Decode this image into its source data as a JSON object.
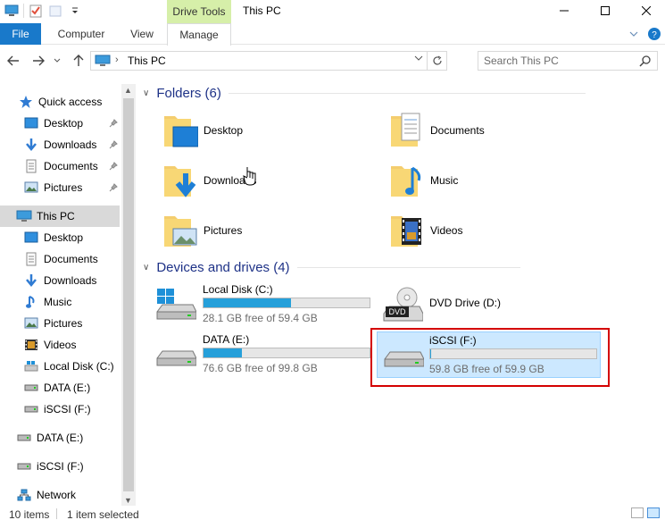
{
  "titlebar": {
    "contextual_tab": "Drive Tools",
    "title": "This PC"
  },
  "ribbon": {
    "tabs": [
      "File",
      "Computer",
      "View",
      "Manage"
    ]
  },
  "address": {
    "path": "This PC",
    "search_placeholder": "Search This PC"
  },
  "nav": {
    "quick_access": "Quick access",
    "quick_items": [
      "Desktop",
      "Downloads",
      "Documents",
      "Pictures"
    ],
    "this_pc": "This PC",
    "pc_items": [
      "Desktop",
      "Documents",
      "Downloads",
      "Music",
      "Pictures",
      "Videos",
      "Local Disk (C:)",
      "DATA (E:)",
      "iSCSI (F:)"
    ],
    "extra_drives": [
      "DATA (E:)",
      "iSCSI (F:)"
    ],
    "network": "Network"
  },
  "folders": {
    "header": "Folders (6)",
    "items": [
      "Desktop",
      "Documents",
      "Downloads",
      "Music",
      "Pictures",
      "Videos"
    ]
  },
  "drives": {
    "header": "Devices and drives (4)",
    "items": [
      {
        "name": "Local Disk (C:)",
        "free": "28.1 GB free of 59.4 GB",
        "used_fraction": 0.527
      },
      {
        "name": "DVD Drive (D:)"
      },
      {
        "name": "DATA (E:)",
        "free": "76.6 GB free of 99.8 GB",
        "used_fraction": 0.232
      },
      {
        "name": "iSCSI (F:)",
        "free": "59.8 GB free of 59.9 GB",
        "used_fraction": 0.002
      }
    ]
  },
  "status": {
    "items": "10 items",
    "selected": "1 item selected"
  },
  "colors": {
    "accent": "#1979ca",
    "drive_tools": "#d6efa9",
    "selection": "#cce8ff",
    "bar_fill": "#26a0da",
    "highlight_box": "#d40000"
  }
}
